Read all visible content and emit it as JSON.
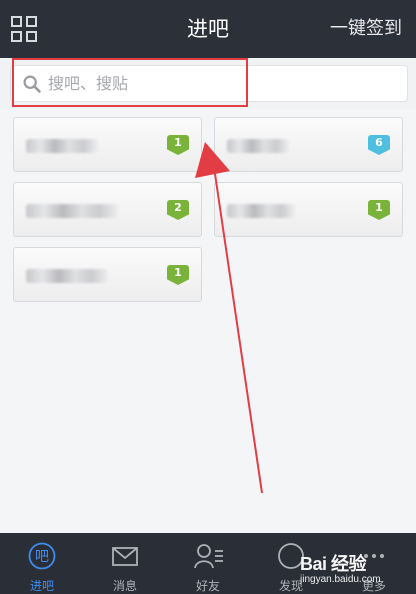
{
  "header": {
    "title": "进吧",
    "action_label": "一键签到"
  },
  "search": {
    "placeholder": "搜吧、搜贴"
  },
  "forums": [
    {
      "badge": "1",
      "badge_color": "#7ab33a"
    },
    {
      "badge": "6",
      "badge_color": "#4fbfe0"
    },
    {
      "badge": "2",
      "badge_color": "#7ab33a"
    },
    {
      "badge": "1",
      "badge_color": "#7ab33a"
    },
    {
      "badge": "1",
      "badge_color": "#7ab33a"
    }
  ],
  "tabs": [
    {
      "label": "进吧",
      "icon_text": "吧",
      "icon": "ba-icon",
      "active": true
    },
    {
      "label": "消息",
      "icon": "envelope-icon"
    },
    {
      "label": "好友",
      "icon": "friends-icon"
    },
    {
      "label": "发现",
      "icon": "discover-icon"
    },
    {
      "label": "更多",
      "icon": "more-icon"
    }
  ],
  "watermark": {
    "brand": "Bai 经验",
    "url": "jingyan.baidu.com"
  },
  "colors": {
    "header_bg": "#2c3038",
    "tabbar_bg": "#2a2e36",
    "active_tab": "#3f8cf0",
    "annotation": "#e23c45"
  }
}
